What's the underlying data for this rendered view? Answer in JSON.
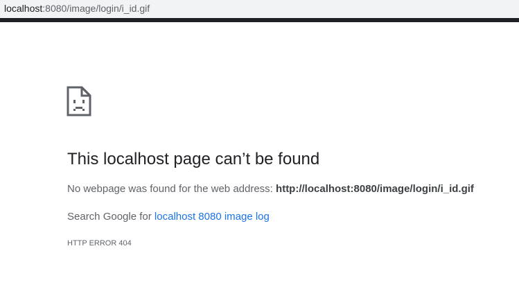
{
  "browser": {
    "address_host": "localhost",
    "address_path": ":8080/image/login/i_id.gif"
  },
  "error_page": {
    "icon": "sad-document-icon",
    "title": "This localhost page can’t be found",
    "message_prefix": "No webpage was found for the web address:",
    "message_url": "http://localhost:8080/image/login/i_id.gif",
    "search_prefix": "Search Google for",
    "search_link": "localhost 8080 image log",
    "error_code": "HTTP ERROR 404"
  },
  "colors": {
    "title": "#202124",
    "body_text": "#5f6368",
    "link": "#1a73e8",
    "address_bar_bg": "#f1f3f4"
  }
}
